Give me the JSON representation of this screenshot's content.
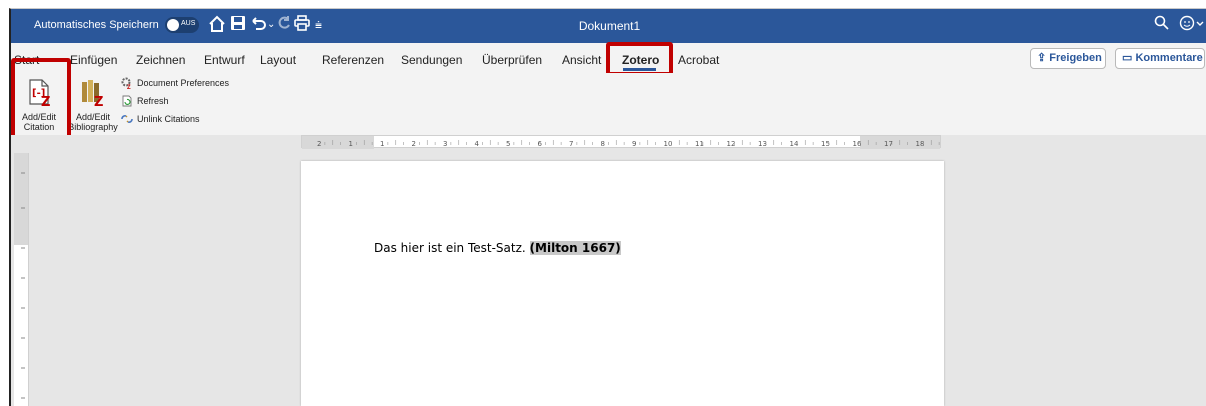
{
  "titlebar": {
    "autosave_label": "Automatisches Speichern",
    "autosave_state": "AUS",
    "document_title": "Dokument1",
    "accent_color": "#2b579a",
    "icons": [
      "home-icon",
      "save-icon",
      "undo-icon",
      "undo-dropdown-icon",
      "redo-icon",
      "print-icon",
      "customize-qat-icon",
      "search-icon",
      "account-icon"
    ]
  },
  "tabs": {
    "items": [
      "Start",
      "Einfügen",
      "Zeichnen",
      "Entwurf",
      "Layout",
      "Referenzen",
      "Sendungen",
      "Überprüfen",
      "Ansicht",
      "Zotero",
      "Acrobat"
    ],
    "active": "Zotero",
    "highlight_color": "#c00000"
  },
  "actions": {
    "share_label": "Freigeben",
    "comments_label": "Kommentare"
  },
  "ribbon": {
    "add_edit_citation": "Add/Edit\nCitation",
    "add_edit_bibliography": "Add/Edit\nBibliography",
    "document_preferences": "Document Preferences",
    "refresh": "Refresh",
    "unlink_citations": "Unlink Citations"
  },
  "ruler": {
    "labels": [
      "2",
      "1",
      "1",
      "2",
      "3",
      "4",
      "5",
      "6",
      "7",
      "8",
      "9",
      "10",
      "11",
      "12",
      "13",
      "14",
      "15",
      "16",
      "17",
      "18"
    ]
  },
  "document": {
    "text": "Das hier ist ein Test-Satz. ",
    "citation": "(Milton 1667)"
  }
}
